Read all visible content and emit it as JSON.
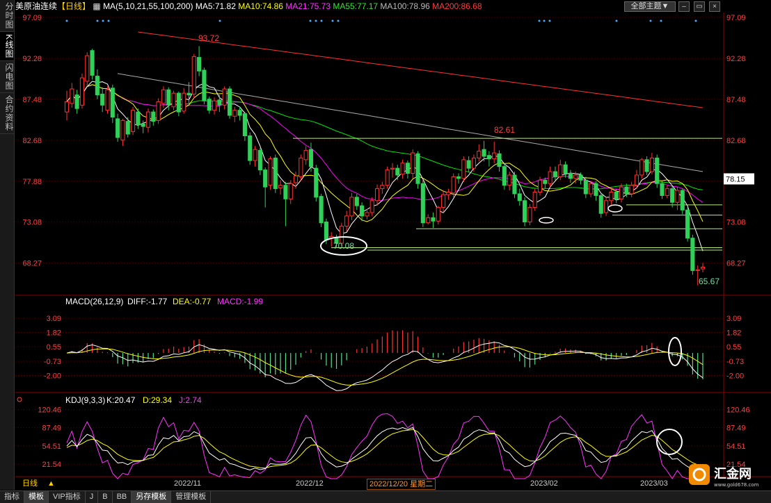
{
  "left_tabs": [
    {
      "label": "分时图",
      "active": false
    },
    {
      "label": "K线图",
      "active": true
    },
    {
      "label": "闪电图",
      "active": false
    },
    {
      "label": "合约资料",
      "active": false
    }
  ],
  "header": {
    "instrument": "美原油连续",
    "period": "【日线】",
    "ma_label": "MA(5,10,21,55,100,200)",
    "ma5": "MA5:71.82",
    "ma10": "MA10:74.86",
    "ma21": "MA21:75.73",
    "ma55": "MA55:77.17",
    "ma100": "MA100:78.96",
    "ma200": "MA200:86.68",
    "theme_button": "全部主题▼"
  },
  "colors": {
    "up": "#ff3232",
    "down": "#54fcfc",
    "down_fill": "#2fd158",
    "ma5": "#ffffff",
    "ma10": "#ffff00",
    "ma21": "#ff00ff",
    "ma55": "#00e400",
    "ma100": "#aaaaaa",
    "ma200": "#ff3030",
    "axis_text": "#ff4040",
    "grid": "#5a0000"
  },
  "chart_data": [
    {
      "type": "candlestick",
      "name": "price",
      "y_ticks": [
        97.09,
        92.28,
        87.48,
        82.68,
        77.88,
        73.08,
        68.27
      ],
      "ylim": [
        64.5,
        97.5
      ],
      "last_price": "78.15",
      "annotations": [
        {
          "text": "93.72",
          "kind": "high"
        },
        {
          "text": "82.61",
          "kind": "high"
        },
        {
          "text": "70.08",
          "kind": "low_circled"
        },
        {
          "text": "65.67",
          "kind": "low"
        }
      ],
      "candles": [
        [
          86.0,
          87.2,
          85.0,
          88.5
        ],
        [
          87.0,
          88.7,
          86.5,
          89.4
        ],
        [
          88.0,
          86.4,
          85.8,
          88.6
        ],
        [
          86.8,
          90.0,
          86.4,
          90.5
        ],
        [
          89.6,
          92.6,
          89.0,
          93.0
        ],
        [
          93.2,
          90.3,
          89.8,
          93.4
        ],
        [
          90.2,
          88.0,
          87.5,
          91.0
        ],
        [
          88.1,
          86.8,
          86.0,
          88.9
        ],
        [
          86.2,
          88.6,
          85.8,
          89.0
        ],
        [
          88.8,
          85.4,
          84.7,
          89.2
        ],
        [
          85.2,
          83.0,
          82.5,
          85.8
        ],
        [
          82.7,
          85.0,
          82.0,
          85.2
        ],
        [
          84.9,
          83.4,
          83.0,
          85.4
        ],
        [
          83.7,
          86.2,
          83.3,
          86.6
        ],
        [
          86.0,
          84.5,
          84.0,
          86.4
        ],
        [
          84.6,
          84.3,
          83.5,
          85.0
        ],
        [
          84.2,
          86.0,
          83.6,
          86.4
        ],
        [
          86.0,
          84.9,
          84.4,
          86.3
        ],
        [
          85.0,
          87.2,
          84.6,
          87.6
        ],
        [
          87.0,
          88.6,
          86.5,
          89.0
        ],
        [
          88.6,
          86.8,
          86.2,
          88.9
        ],
        [
          86.6,
          88.2,
          86.2,
          88.5
        ],
        [
          88.2,
          86.0,
          85.5,
          88.4
        ],
        [
          86.1,
          88.2,
          85.8,
          88.8
        ],
        [
          88.2,
          88.0,
          87.0,
          89.5
        ],
        [
          88.1,
          92.5,
          87.6,
          92.8
        ],
        [
          92.4,
          90.8,
          90.2,
          93.72
        ],
        [
          90.9,
          87.3,
          86.9,
          91.2
        ],
        [
          87.5,
          86.2,
          85.8,
          87.8
        ],
        [
          86.2,
          87.3,
          85.7,
          87.7
        ],
        [
          87.4,
          86.8,
          86.0,
          88.0
        ],
        [
          86.8,
          88.7,
          86.3,
          89.0
        ],
        [
          88.7,
          85.6,
          85.2,
          89.0
        ],
        [
          85.5,
          86.2,
          84.8,
          86.6
        ],
        [
          86.2,
          85.6,
          85.0,
          86.6
        ],
        [
          85.8,
          83.2,
          82.6,
          86.0
        ],
        [
          83.2,
          80.3,
          79.8,
          83.6
        ],
        [
          80.3,
          81.6,
          79.6,
          82.0
        ],
        [
          81.5,
          79.2,
          78.6,
          81.8
        ],
        [
          79.2,
          77.2,
          74.8,
          79.5
        ],
        [
          77.4,
          80.5,
          76.9,
          80.8
        ],
        [
          80.6,
          77.0,
          76.5,
          81.0
        ],
        [
          77.1,
          77.4,
          76.3,
          78.0
        ],
        [
          77.4,
          75.8,
          72.6,
          77.8
        ],
        [
          75.8,
          77.6,
          75.2,
          78.0
        ],
        [
          77.7,
          78.5,
          77.0,
          79.0
        ],
        [
          78.4,
          80.6,
          78.0,
          81.0
        ],
        [
          80.4,
          81.5,
          79.8,
          82.0
        ],
        [
          81.6,
          79.6,
          79.0,
          82.4
        ],
        [
          79.4,
          76.0,
          75.5,
          79.8
        ],
        [
          76.1,
          73.0,
          72.5,
          76.4
        ],
        [
          73.1,
          71.0,
          70.5,
          73.5
        ],
        [
          71.2,
          71.4,
          70.2,
          71.9
        ],
        [
          71.2,
          70.6,
          70.08,
          71.6
        ],
        [
          70.6,
          72.6,
          70.3,
          73.0
        ],
        [
          72.6,
          73.8,
          72.0,
          74.4
        ],
        [
          73.8,
          76.0,
          73.3,
          76.5
        ],
        [
          76.0,
          75.0,
          74.5,
          76.4
        ],
        [
          75.0,
          73.8,
          73.2,
          75.4
        ],
        [
          73.8,
          74.2,
          73.4,
          74.6
        ],
        [
          74.2,
          75.6,
          73.8,
          76.0
        ],
        [
          75.6,
          77.0,
          75.0,
          77.5
        ],
        [
          77.0,
          77.4,
          76.4,
          77.8
        ],
        [
          77.4,
          79.2,
          77.0,
          79.6
        ],
        [
          79.3,
          79.4,
          78.3,
          80.0
        ],
        [
          79.4,
          78.6,
          78.0,
          79.8
        ],
        [
          78.7,
          80.0,
          78.2,
          80.4
        ],
        [
          80.0,
          78.8,
          78.2,
          80.3
        ],
        [
          78.8,
          81.2,
          78.2,
          81.6
        ],
        [
          81.1,
          77.6,
          77.0,
          81.4
        ],
        [
          77.6,
          73.0,
          72.5,
          78.0
        ],
        [
          73.0,
          73.6,
          72.8,
          74.0
        ],
        [
          73.6,
          73.2,
          72.4,
          74.2
        ],
        [
          73.2,
          74.8,
          72.8,
          75.0
        ],
        [
          74.8,
          76.3,
          74.2,
          76.8
        ],
        [
          76.3,
          76.6,
          75.7,
          77.0
        ],
        [
          76.5,
          78.4,
          76.0,
          78.8
        ],
        [
          78.4,
          78.2,
          77.6,
          78.8
        ],
        [
          78.2,
          80.4,
          77.8,
          80.8
        ],
        [
          80.3,
          79.4,
          78.9,
          80.8
        ],
        [
          79.4,
          80.6,
          79.0,
          81.0
        ],
        [
          80.6,
          81.4,
          80.2,
          82.2
        ],
        [
          81.6,
          80.8,
          80.2,
          82.61
        ],
        [
          80.9,
          80.5,
          79.6,
          81.4
        ],
        [
          80.5,
          81.2,
          80.0,
          82.5
        ],
        [
          81.1,
          79.6,
          79.0,
          81.5
        ],
        [
          79.6,
          77.4,
          76.9,
          80.0
        ],
        [
          77.4,
          78.6,
          76.8,
          79.0
        ],
        [
          78.6,
          76.4,
          75.9,
          79.0
        ],
        [
          76.4,
          75.6,
          75.0,
          77.0
        ],
        [
          75.6,
          73.1,
          72.6,
          76.0
        ],
        [
          73.1,
          74.8,
          72.7,
          75.2
        ],
        [
          74.8,
          76.6,
          74.4,
          77.0
        ],
        [
          76.6,
          78.0,
          76.2,
          78.4
        ],
        [
          78.0,
          77.6,
          77.0,
          78.3
        ],
        [
          77.6,
          79.0,
          77.2,
          79.6
        ],
        [
          79.0,
          78.4,
          78.0,
          79.6
        ],
        [
          78.4,
          79.8,
          78.0,
          80.4
        ],
        [
          79.8,
          78.8,
          78.3,
          80.2
        ],
        [
          78.8,
          78.2,
          77.7,
          79.2
        ],
        [
          78.2,
          78.6,
          77.6,
          79.0
        ],
        [
          78.6,
          78.0,
          77.5,
          78.9
        ],
        [
          78.0,
          76.4,
          75.9,
          78.4
        ],
        [
          76.4,
          77.6,
          76.0,
          77.9
        ],
        [
          77.6,
          76.2,
          75.6,
          77.9
        ],
        [
          76.2,
          74.1,
          73.6,
          76.5
        ],
        [
          74.2,
          75.6,
          73.8,
          76.0
        ],
        [
          75.6,
          76.6,
          75.0,
          77.0
        ],
        [
          76.6,
          75.8,
          75.3,
          77.0
        ],
        [
          75.8,
          77.2,
          75.4,
          77.6
        ],
        [
          77.2,
          76.4,
          76.0,
          77.6
        ],
        [
          76.4,
          77.4,
          76.0,
          77.8
        ],
        [
          77.4,
          78.6,
          77.0,
          79.2
        ],
        [
          78.6,
          80.4,
          78.2,
          80.6
        ],
        [
          80.4,
          79.0,
          78.6,
          80.8
        ],
        [
          79.0,
          80.6,
          78.7,
          81.2
        ],
        [
          80.6,
          77.6,
          77.1,
          81.0
        ],
        [
          77.6,
          76.2,
          75.8,
          78.0
        ],
        [
          76.2,
          77.0,
          75.9,
          77.4
        ],
        [
          77.0,
          75.4,
          74.8,
          77.3
        ],
        [
          75.4,
          76.8,
          74.5,
          77.2
        ],
        [
          76.8,
          74.5,
          74.0,
          77.0
        ],
        [
          74.5,
          71.2,
          70.8,
          74.8
        ],
        [
          71.2,
          67.4,
          66.9,
          71.6
        ],
        [
          67.4,
          67.5,
          65.67,
          68.0
        ],
        [
          67.6,
          67.8,
          67.2,
          68.3
        ]
      ]
    },
    {
      "type": "bar_line",
      "name": "MACD",
      "label": "MACD(26,12,9)",
      "diff_label": "DIFF:-1.77",
      "dea_label": "DEA:-0.77",
      "macd_label": "MACD:-1.99",
      "y_ticks": [
        3.09,
        1.82,
        0.55,
        -0.73,
        -2.0
      ],
      "ylim": [
        -3.2,
        4.2
      ]
    },
    {
      "type": "line",
      "name": "KDJ",
      "label": "KDJ(9,3,3)",
      "k_label": "K:20.47",
      "d_label": "D:29.34",
      "j_label": "J:2.74",
      "y_ticks": [
        120.46,
        87.49,
        54.51,
        21.54
      ],
      "ylim": [
        0,
        135
      ]
    }
  ],
  "x_axis": {
    "labels": [
      "2022/11",
      "2022/12",
      "2023/02",
      "2023/03"
    ],
    "cursor_date": "2022/12/20 星期二",
    "period_label": "日线"
  },
  "bottom_tabs": [
    {
      "label": "指标",
      "active": false
    },
    {
      "label": "模板",
      "active": true
    },
    {
      "label": "VIP指标",
      "active": false
    },
    {
      "label": "J",
      "active": false
    },
    {
      "label": "B",
      "active": false
    },
    {
      "label": "BB",
      "active": false
    },
    {
      "label": "另存模板",
      "active": true
    },
    {
      "label": "管理模板",
      "active": false
    }
  ],
  "watermark": {
    "brand": "汇金网",
    "url": "www.gold678.com"
  }
}
